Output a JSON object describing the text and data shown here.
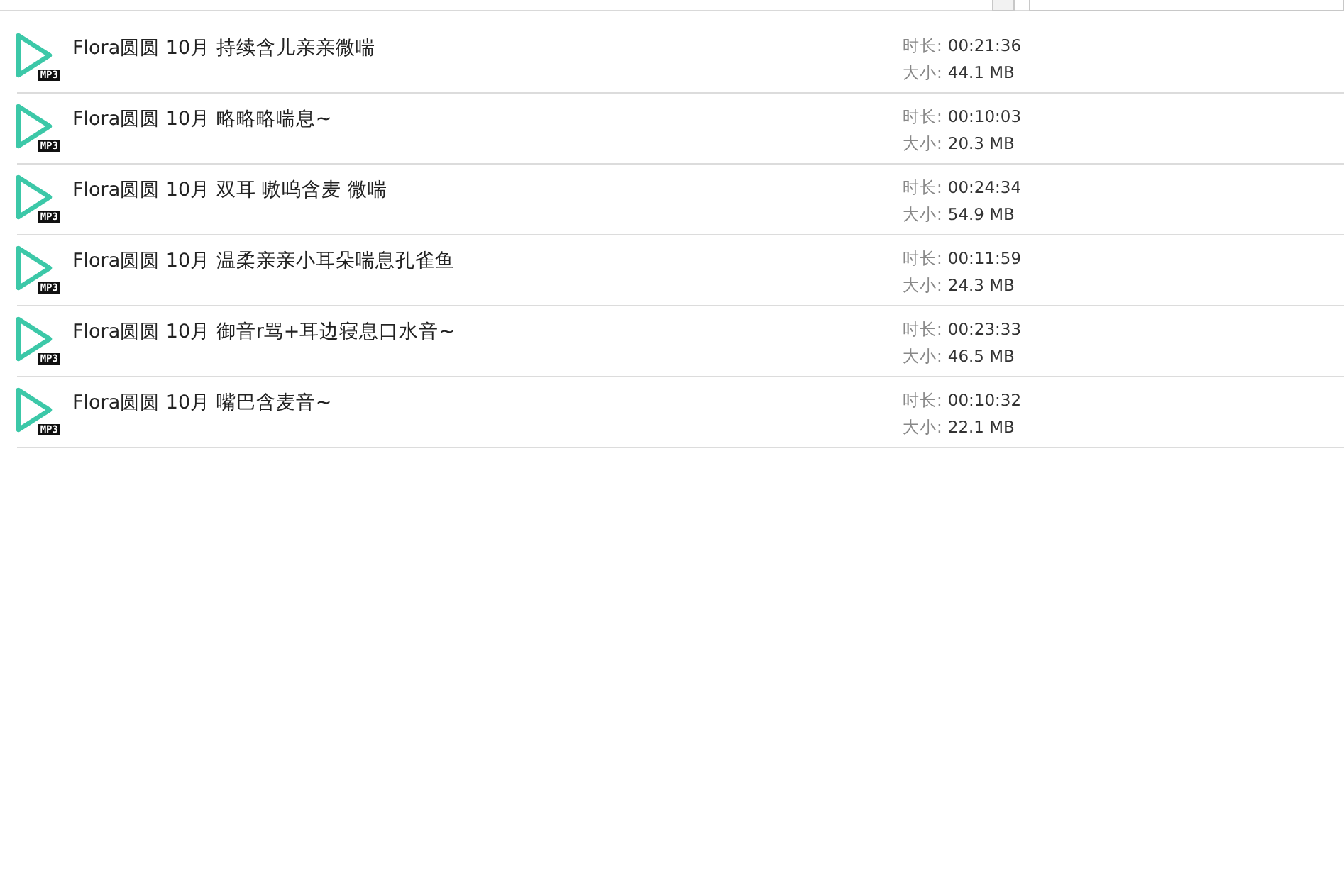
{
  "files": [
    {
      "title": "Flora圆圆 10月 持续含儿亲亲微喘",
      "badge": "MP3",
      "duration_label": "时长:",
      "duration": "00:21:36",
      "size_label": "大小:",
      "size": "44.1 MB"
    },
    {
      "title": "Flora圆圆 10月 略略略喘息~",
      "badge": "MP3",
      "duration_label": "时长:",
      "duration": "00:10:03",
      "size_label": "大小:",
      "size": "20.3 MB"
    },
    {
      "title": "Flora圆圆 10月 双耳 嗷呜含麦 微喘",
      "badge": "MP3",
      "duration_label": "时长:",
      "duration": "00:24:34",
      "size_label": "大小:",
      "size": "54.9 MB"
    },
    {
      "title": "Flora圆圆 10月 温柔亲亲小耳朵喘息孔雀鱼",
      "badge": "MP3",
      "duration_label": "时长:",
      "duration": "00:11:59",
      "size_label": "大小:",
      "size": "24.3 MB"
    },
    {
      "title": "Flora圆圆 10月 御音r骂+耳边寝息口水音~",
      "badge": "MP3",
      "duration_label": "时长:",
      "duration": "00:23:33",
      "size_label": "大小:",
      "size": "46.5 MB"
    },
    {
      "title": "Flora圆圆 10月 嘴巴含麦音~",
      "badge": "MP3",
      "duration_label": "时长:",
      "duration": "00:10:32",
      "size_label": "大小:",
      "size": "22.1 MB"
    }
  ]
}
